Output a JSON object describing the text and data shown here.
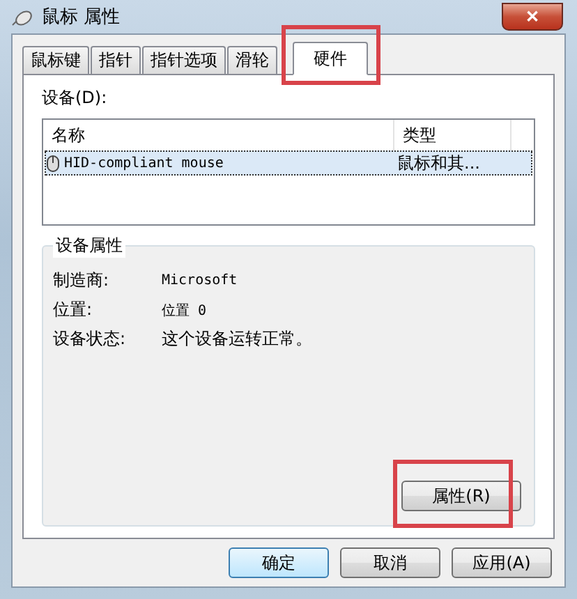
{
  "window": {
    "title": "鼠标 属性",
    "close": "✕"
  },
  "tabs": [
    {
      "label": "鼠标键",
      "selected": false,
      "highlighted": false
    },
    {
      "label": "指针",
      "selected": false,
      "highlighted": false
    },
    {
      "label": "指针选项",
      "selected": false,
      "highlighted": false
    },
    {
      "label": "滑轮",
      "selected": false,
      "highlighted": false
    },
    {
      "label": "硬件",
      "selected": true,
      "highlighted": true
    }
  ],
  "devices": {
    "label": "设备(D):",
    "columns": [
      "名称",
      "类型"
    ],
    "rows": [
      {
        "name": "HID-compliant mouse",
        "type": "鼠标和其...",
        "selected": true
      }
    ]
  },
  "device_properties": {
    "title": "设备属性",
    "fields": [
      {
        "label": "制造商:",
        "value": "Microsoft"
      },
      {
        "label": "位置:",
        "value": "位置 0"
      },
      {
        "label": "设备状态:",
        "value": "这个设备运转正常。"
      }
    ],
    "button": {
      "label": "属性(R)",
      "highlighted": true
    }
  },
  "buttons": [
    {
      "label": "确定",
      "default": true
    },
    {
      "label": "取消",
      "default": false
    },
    {
      "label": "应用(A)",
      "default": false
    }
  ]
}
